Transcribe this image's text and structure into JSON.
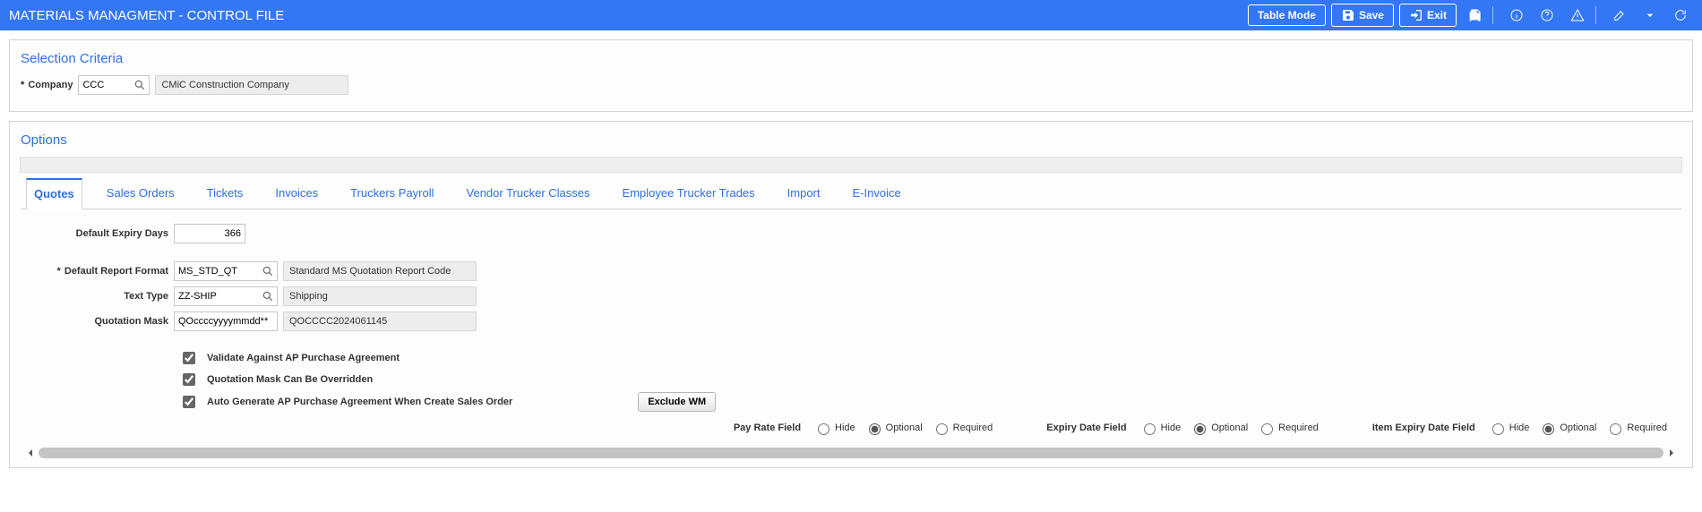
{
  "header": {
    "title": "MATERIALS MANAGMENT - CONTROL FILE",
    "table_mode": "Table Mode",
    "save": "Save",
    "exit": "Exit"
  },
  "selection": {
    "title": "Selection Criteria",
    "company_label": "Company",
    "company_value": "CCC",
    "company_name": "CMiC Construction Company"
  },
  "options": {
    "title": "Options",
    "tabs": [
      "Quotes",
      "Sales Orders",
      "Tickets",
      "Invoices",
      "Truckers Payroll",
      "Vendor Trucker Classes",
      "Employee Trucker Trades",
      "Import",
      "E-Invoice"
    ],
    "quotes": {
      "default_expiry_days_label": "Default Expiry Days",
      "default_expiry_days": "366",
      "default_report_format_label": "Default Report Format",
      "default_report_format": "MS_STD_QT",
      "default_report_format_desc": "Standard MS Quotation Report Code",
      "text_type_label": "Text Type",
      "text_type": "ZZ-SHIP",
      "text_type_desc": "Shipping",
      "quotation_mask_label": "Quotation Mask",
      "quotation_mask": "QOccccyyyymmdd**",
      "quotation_mask_example": "QOCCCC2024061145",
      "chk_validate_ap": "Validate Against AP Purchase Agreement",
      "chk_mask_override": "Quotation Mask Can Be Overridden",
      "chk_autogen_ap": "Auto Generate AP Purchase Agreement When Create Sales Order",
      "exclude_wm": "Exclude WM",
      "radio_groups": {
        "pay_rate": {
          "label": "Pay Rate Field",
          "hide": "Hide",
          "optional": "Optional",
          "required": "Required",
          "selected": "optional"
        },
        "expiry_date": {
          "label": "Expiry Date Field",
          "hide": "Hide",
          "optional": "Optional",
          "required": "Required",
          "selected": "optional"
        },
        "item_expiry": {
          "label": "Item Expiry Date Field",
          "hide": "Hide",
          "optional": "Optional",
          "required": "Required",
          "selected": "optional"
        }
      }
    }
  }
}
